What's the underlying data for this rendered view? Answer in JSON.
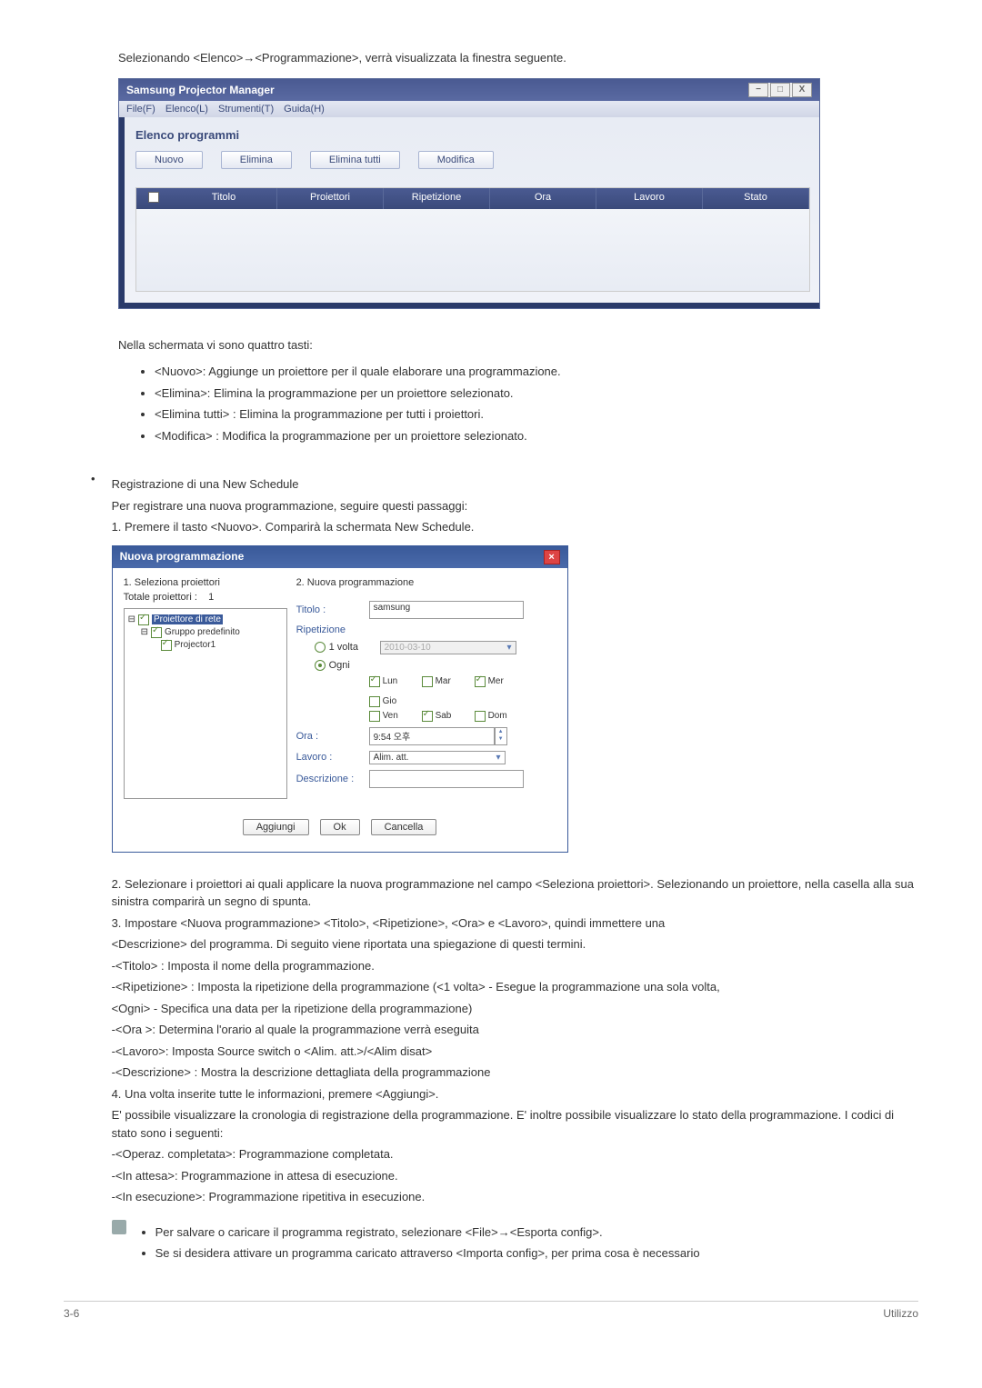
{
  "intro": "Selezionando <Elenco>→<Programmazione>, verrà visualizzata la finestra seguente.",
  "window1": {
    "title": "Samsung Projector Manager",
    "minimize": "−",
    "maximize": "□",
    "close": "X",
    "menu_file": "File(F)",
    "menu_elenco": "Elenco(L)",
    "menu_strumenti": "Strumenti(T)",
    "menu_guida": "Guida(H)",
    "section_title": "Elenco programmi",
    "btn_nuovo": "Nuovo",
    "btn_elimina": "Elimina",
    "btn_elimina_tutti": "Elimina tutti",
    "btn_modifica": "Modifica",
    "col_titolo": "Titolo",
    "col_proiettori": "Proiettori",
    "col_ripetizione": "Ripetizione",
    "col_ora": "Ora",
    "col_lavoro": "Lavoro",
    "col_stato": "Stato"
  },
  "para_tasti": "Nella schermata vi sono quattro tasti:",
  "bullets1": {
    "b1": "<Nuovo>: Aggiunge un proiettore per il quale elaborare una programmazione.",
    "b2": "<Elimina>: Elimina la programmazione per un proiettore selezionato.",
    "b3": "<Elimina tutti> : Elimina la programmazione per tutti i proiettori.",
    "b4": "<Modifica> : Modifica la programmazione per un proiettore selezionato."
  },
  "reg_title": "Registrazione di una New Schedule",
  "reg_p1": "Per registrare una nuova programmazione, seguire questi passaggi:",
  "reg_p2": "1. Premere il tasto <Nuovo>. Comparirà la schermata New Schedule.",
  "dialog2": {
    "title": "Nuova programmazione",
    "close": "×",
    "sec1": "1. Seleziona proiettori",
    "totale": "Totale proiettori :",
    "totale_val": "1",
    "tree_root": "Proiettore di rete",
    "tree_group": "Gruppo predefinito",
    "tree_item": "Projector1",
    "sec2": "2. Nuova programmazione",
    "lbl_titolo": "Titolo :",
    "val_titolo": "samsung",
    "lbl_ripetizione": "Ripetizione",
    "opt_1volta": "1 volta",
    "opt_1volta_date": "2010-03-10",
    "opt_ogni": "Ogni",
    "day_lun": "Lun",
    "day_mar": "Mar",
    "day_mer": "Mer",
    "day_gio": "Gio",
    "day_ven": "Ven",
    "day_sab": "Sab",
    "day_dom": "Dom",
    "lbl_ora": "Ora :",
    "val_ora": "9:54 오후",
    "lbl_lavoro": "Lavoro :",
    "val_lavoro": "Alim. att.",
    "lbl_descrizione": "Descrizione :",
    "btn_aggiungi": "Aggiungi",
    "btn_ok": "Ok",
    "btn_cancella": "Cancella"
  },
  "step2": "2. Selezionare i proiettori ai quali applicare la nuova programmazione nel campo <Seleziona proiettori>. Selezionando un proiettore, nella casella alla sua sinistra comparirà un segno di spunta.",
  "step3a": "3. Impostare <Nuova programmazione> <Titolo>, <Ripetizione>, <Ora> e <Lavoro>, quindi immettere una",
  "step3b": "<Descrizione> del programma. Di seguito viene riportata una spiegazione di questi termini.",
  "d_titolo": "-<Titolo> : Imposta il nome della programmazione.",
  "d_ripetizione": "-<Ripetizione> : Imposta la ripetizione della programmazione (<1 volta> - Esegue la programmazione una sola volta,",
  "d_ogni": "<Ogni> - Specifica una data per la ripetizione della programmazione)",
  "d_ora": "-<Ora >: Determina l'orario al quale la programmazione verrà eseguita",
  "d_lavoro": "-<Lavoro>: Imposta Source switch o <Alim. att.>/<Alim disat>",
  "d_descrizione": "-<Descrizione> : Mostra la descrizione dettagliata della programmazione",
  "step4": "4. Una volta inserite tutte le informazioni, premere <Aggiungi>.",
  "hist1": "E' possibile visualizzare la cronologia di registrazione della programmazione. E' inoltre possibile visualizzare lo stato della programmazione. I codici di stato sono i seguenti:",
  "s_completata": "-<Operaz. completata>: Programmazione completata.",
  "s_attesa": "-<In attesa>: Programmazione in attesa di esecuzione.",
  "s_esecuzione": "-<In esecuzione>: Programmazione ripetitiva in esecuzione.",
  "note1": "Per salvare o caricare il programma registrato, selezionare <File>→<Esporta config>.",
  "note2": "Se si desidera attivare un programma caricato attraverso <Importa config>, per prima cosa è necessario",
  "footer_left": "3-6",
  "footer_right": "Utilizzo"
}
